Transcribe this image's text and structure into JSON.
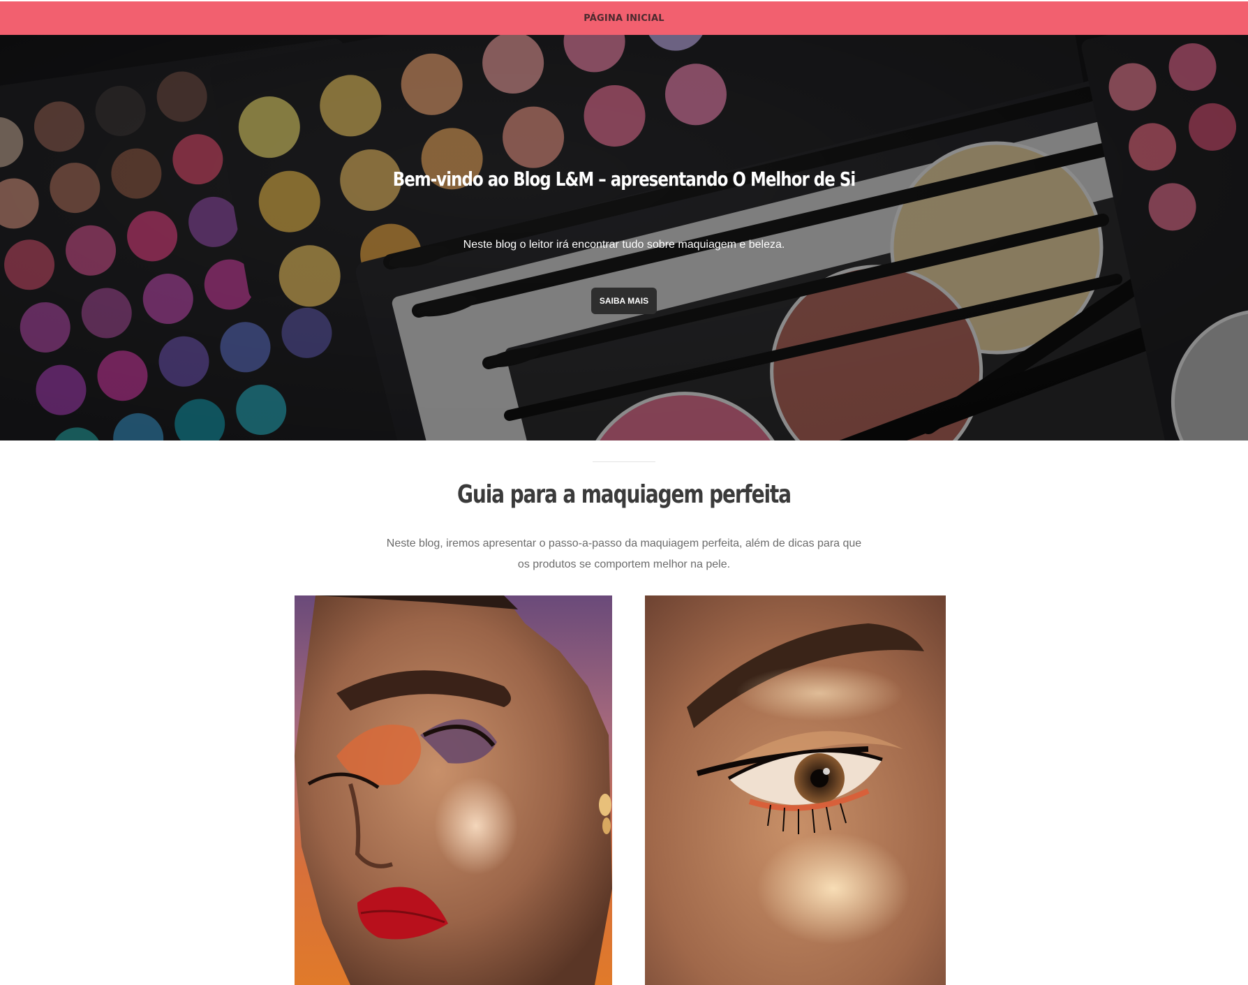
{
  "nav": {
    "home_label": "PÁGINA INICIAL",
    "bar_color": "#f2606f"
  },
  "hero": {
    "title": "Bem-vindo ao Blog L&M – apresentando O Melhor de Si",
    "subtitle": "Neste blog o leitor irá encontrar tudo sobre maquiagem e beleza.",
    "button_label": "SAIBA MAIS"
  },
  "section": {
    "title": "Guia para a maquiagem perfeita",
    "text": "Neste blog, iremos apresentar o passo-a-passo da maquiagem perfeita, além de dicas para que os produtos se comportem melhor na pele."
  }
}
